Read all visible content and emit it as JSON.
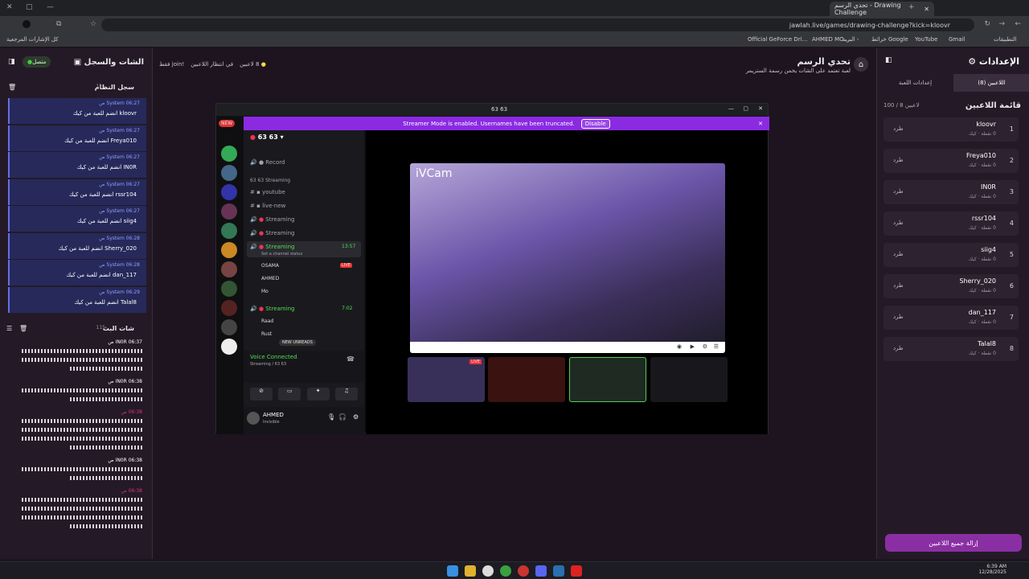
{
  "browser": {
    "tab_title": "تحدي الرسم - Drawing Challenge",
    "url": "jawlah.live/games/drawing-challenge?kick=kloovr",
    "bookmarks": [
      "Official GeForce Dri...",
      "AHMED MO...",
      "البريد -",
      "خرائط Google",
      "YouTube",
      "Gmail",
      "التطبيقات",
      "كل الإشارات المرجعية"
    ]
  },
  "settings": {
    "title": "الإعدادات",
    "tab_players": "اللاعبين (8)",
    "tab_game": "إعدادات اللعبة",
    "players_title": "قائمة اللاعبين",
    "players_count": "100 / 8 لاعبين",
    "kick_label": "طرد",
    "players": [
      {
        "num": "1",
        "name": "kloovr",
        "stat": "0 نقطة · كيك"
      },
      {
        "num": "2",
        "name": "Freya010",
        "stat": "0 نقطة · كيك"
      },
      {
        "num": "3",
        "name": "IN0R",
        "stat": "0 نقطة · كيك"
      },
      {
        "num": "4",
        "name": "rssr104",
        "stat": "0 نقطة · كيك"
      },
      {
        "num": "5",
        "name": "siig4",
        "stat": "0 نقطة · كيك"
      },
      {
        "num": "6",
        "name": "Sherry_020",
        "stat": "0 نقطة · كيك"
      },
      {
        "num": "7",
        "name": "dan_117",
        "stat": "0 نقطة · كيك"
      },
      {
        "num": "8",
        "name": "Talal8",
        "stat": "0 نقطة · كيك"
      }
    ],
    "remove_all": "إزالة جميع اللاعبين"
  },
  "chat": {
    "title": "الشات والسجل",
    "online": "متصل",
    "syslog_title": "سجل النظام",
    "syslog_count": "11",
    "livechat_title": "شات البث",
    "livechat_count": "115",
    "system_messages": [
      {
        "meta": "System 06:27 ص",
        "text": "kloovr انضم للعبة من كيك"
      },
      {
        "meta": "System 06:27 ص",
        "text": "Freya010 انضم للعبة من كيك"
      },
      {
        "meta": "System 06:27 ص",
        "text": "IN0R انضم للعبة من كيك"
      },
      {
        "meta": "System 06:27 ص",
        "text": "rssr104 انضم للعبة من كيك"
      },
      {
        "meta": "System 06:27 ص",
        "text": "siig4 انضم للعبة من كيك"
      },
      {
        "meta": "System 06:28 ص",
        "text": "Sherry_020 انضم للعبة من كيك"
      },
      {
        "meta": "System 06:28 ص",
        "text": "dan_117 انضم للعبة من كيك"
      },
      {
        "meta": "System 06:29 ص",
        "text": "Talal8 انضم للعبة من كيك"
      }
    ],
    "live_messages": [
      {
        "meta": "IN0R 06:37 ص",
        "color": "#ffffff"
      },
      {
        "meta": "IN0R 06:38 ص",
        "color": "#ffffff"
      },
      {
        "meta": "06:38 ص",
        "color": "#e0307a"
      },
      {
        "meta": "IN0R 06:38 ص",
        "color": "#ffffff"
      },
      {
        "meta": "06:38 ص",
        "color": "#e0307a"
      }
    ]
  },
  "game": {
    "title": "تحدي الرسم",
    "subtitle": "لعبة تعتمد على الشات يخمن رسمة الستريمر",
    "players_status": "8 لاعبين",
    "waiting_status": "في انتظار اللاعبين",
    "join_status": "!join فقط"
  },
  "discord": {
    "window_title": "63 63",
    "banner_text": "Streamer Mode is enabled. Usernames have been truncated.",
    "banner_button": "Disable",
    "server_name": "63 63",
    "new_badge": "NEW",
    "category": "63 63 Streaming",
    "channels": [
      "Record",
      "youtube",
      "live-new",
      "Streaming",
      "Streaming",
      "Streaming",
      "Streaming"
    ],
    "selected_time": "13:57",
    "channel_status": "Set a channel status",
    "voice_users": [
      "OSAMA",
      "AHMED",
      "Mo"
    ],
    "live_badge": "LIVE",
    "second_time": "7:02",
    "second_users": [
      "Raad",
      "Rust"
    ],
    "new_unreads": "NEW UNREADS",
    "voice_connected": "Voice Connected",
    "voice_channel": "Streaming / 63 63",
    "username": "AHMED",
    "user_status": "Invisible",
    "camera_label": "iVCam"
  },
  "taskbar": {
    "time": "6:39 AM",
    "date": "12/28/2025"
  }
}
